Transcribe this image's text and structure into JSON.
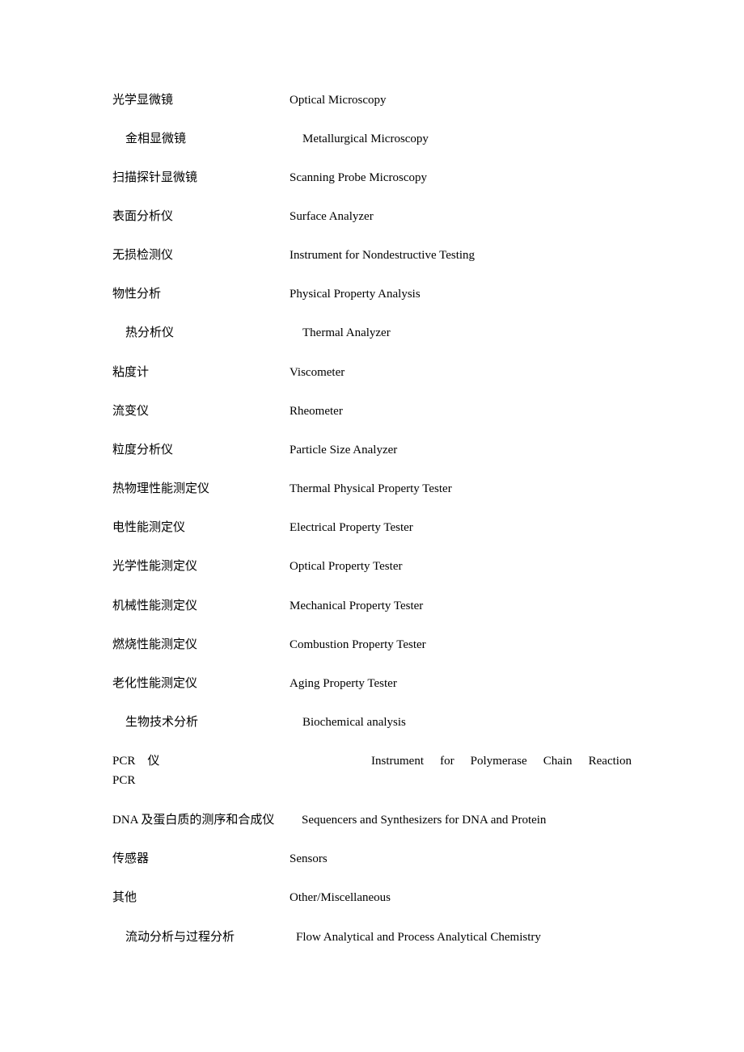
{
  "entries": [
    {
      "zh": "光学显微镜",
      "en": "Optical Microscopy"
    },
    {
      "zh": "金相显微镜",
      "en": "Metallurgical Microscopy"
    },
    {
      "zh": "扫描探针显微镜",
      "en": "Scanning Probe Microscopy"
    },
    {
      "zh": "表面分析仪",
      "en": "Surface Analyzer"
    },
    {
      "zh": "无损检测仪",
      "en": "Instrument for Nondestructive Testing"
    },
    {
      "zh": "物性分析",
      "en": "Physical Property Analysis"
    },
    {
      "zh": "热分析仪",
      "en": "Thermal Analyzer"
    },
    {
      "zh": "粘度计",
      "en": "Viscometer"
    },
    {
      "zh": "流变仪",
      "en": "Rheometer"
    },
    {
      "zh": "粒度分析仪",
      "en": "Particle Size Analyzer"
    },
    {
      "zh": "热物理性能测定仪",
      "en": "Thermal Physical Property Tester"
    },
    {
      "zh": "电性能测定仪",
      "en": "Electrical Property Tester"
    },
    {
      "zh": "光学性能测定仪",
      "en": "Optical Property Tester"
    },
    {
      "zh": "机械性能测定仪",
      "en": "Mechanical Property Tester"
    },
    {
      "zh": "燃烧性能测定仪",
      "en": "Combustion Property Tester"
    },
    {
      "zh": "老化性能测定仪",
      "en": "Aging Property Tester"
    },
    {
      "zh": "生物技术分析",
      "en": "Biochemical analysis"
    }
  ],
  "pcr": {
    "zh": "PCR　仪",
    "en_words": [
      "Instrument",
      "for",
      "Polymerase",
      "Chain",
      "Reaction"
    ],
    "en_cont": "PCR"
  },
  "tail": [
    {
      "zh": "DNA 及蛋白质的测序和合成仪",
      "en": "Sequencers and Synthesizers for DNA and Protein"
    },
    {
      "zh": "传感器",
      "en": "Sensors"
    },
    {
      "zh": "其他",
      "en": "Other/Miscellaneous"
    },
    {
      "zh": "流动分析与过程分析",
      "en": "Flow Analytical and Process Analytical Chemistry"
    }
  ]
}
